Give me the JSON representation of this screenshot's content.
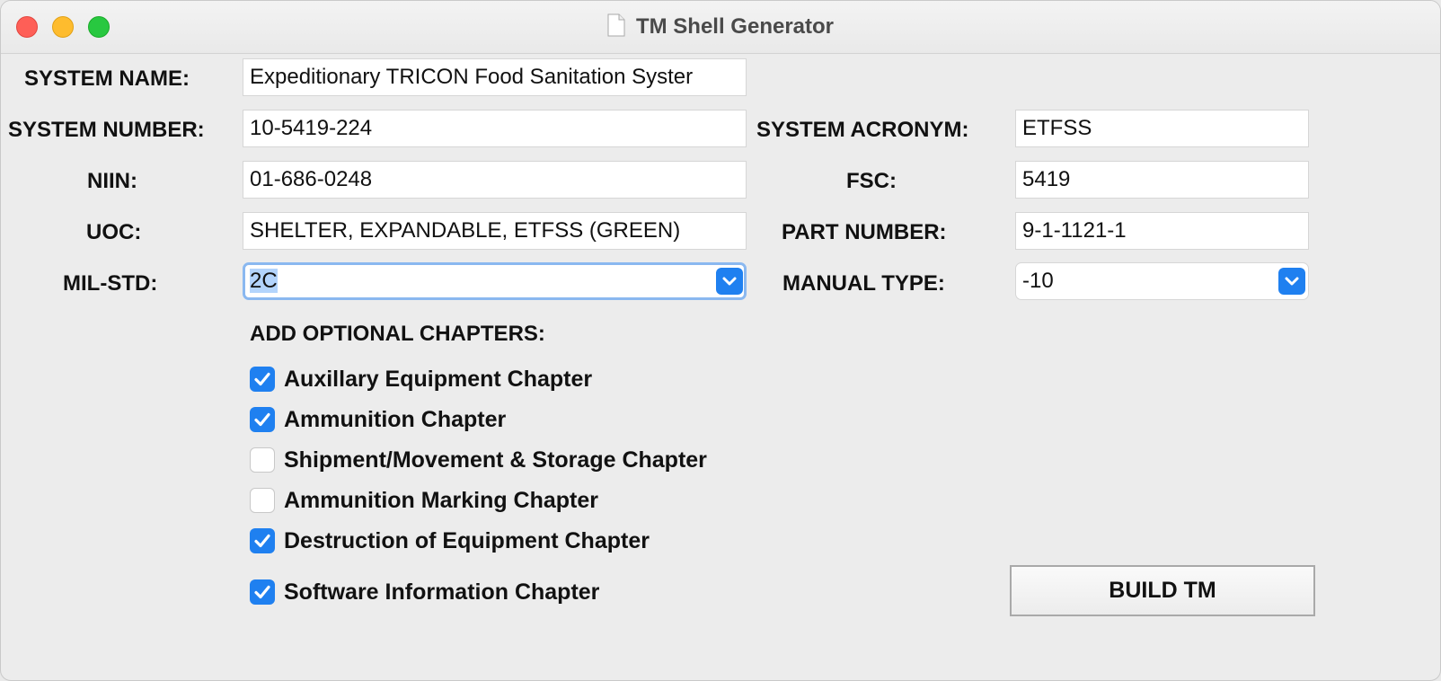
{
  "window": {
    "title": "TM Shell Generator"
  },
  "form": {
    "system_name": {
      "label": "SYSTEM NAME:",
      "value": "Expeditionary TRICON Food Sanitation Syster"
    },
    "system_number": {
      "label": "SYSTEM NUMBER:",
      "value": "10-5419-224"
    },
    "system_acronym": {
      "label": "SYSTEM ACRONYM:",
      "value": "ETFSS"
    },
    "niin": {
      "label": "NIIN:",
      "value": "01-686-0248"
    },
    "fsc": {
      "label": "FSC:",
      "value": "5419"
    },
    "uoc": {
      "label": "UOC:",
      "value": "SHELTER, EXPANDABLE, ETFSS (GREEN)"
    },
    "part_number": {
      "label": "PART NUMBER:",
      "value": "9-1-1121-1"
    },
    "mil_std": {
      "label": "MIL-STD:",
      "value": "2C"
    },
    "manual_type": {
      "label": "MANUAL TYPE:",
      "value": "-10"
    }
  },
  "optional_chapters": {
    "heading": "ADD OPTIONAL CHAPTERS:",
    "items": [
      {
        "label": "Auxillary Equipment Chapter",
        "checked": true
      },
      {
        "label": "Ammunition Chapter",
        "checked": true
      },
      {
        "label": "Shipment/Movement & Storage Chapter",
        "checked": false
      },
      {
        "label": "Ammunition Marking Chapter",
        "checked": false
      },
      {
        "label": "Destruction of Equipment Chapter",
        "checked": true
      },
      {
        "label": "Software Information Chapter",
        "checked": true
      }
    ]
  },
  "actions": {
    "build_label": "BUILD TM"
  },
  "colors": {
    "accent": "#1f80f0",
    "focus_ring": "#8ab8f0",
    "selection": "#b3d4fc"
  }
}
